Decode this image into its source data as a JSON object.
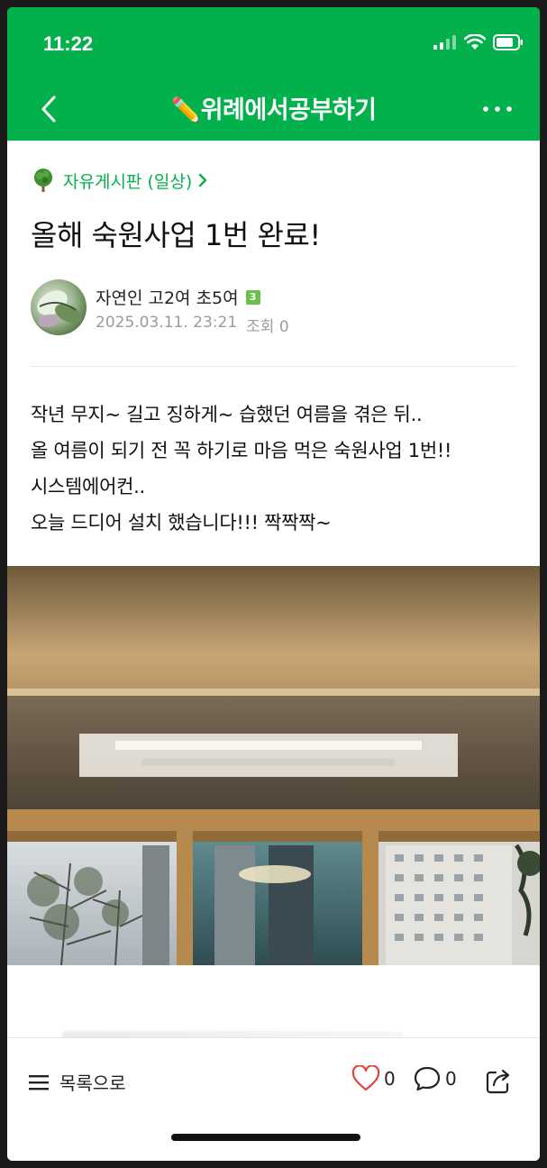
{
  "status_bar": {
    "time": "11:22"
  },
  "header": {
    "cafe_title": "✏️위례에서공부하기"
  },
  "post": {
    "board": "자유게시판 (일상)",
    "title": "올해 숙원사업 1번 완료!",
    "author": {
      "name": "자연인 고2여 초5여",
      "level": "3"
    },
    "date": "2025.03.11. 23:21",
    "views_label": "조회 0",
    "body_lines": [
      "작년 무지~ 길고 징하게~ 습했던 여름을 겪은 뒤..",
      "올 여름이 되기 전 꼭 하기로 마음 먹은 숙원사업 1번!!",
      "시스템에어컨..",
      "오늘 드디어 설치 했습니다!!! 짝짝짝~"
    ]
  },
  "bottom_bar": {
    "list_label": "목록으로",
    "like_count": "0",
    "comment_count": "0"
  },
  "icons": {
    "back": "chevron-left-icon",
    "more": "more-horizontal-icon",
    "board": "tree-icon",
    "list": "menu-icon",
    "like": "heart-icon",
    "comment": "comment-icon",
    "share": "share-icon"
  },
  "colors": {
    "brand_green": "#03b14c",
    "like_red": "#e0413a"
  }
}
